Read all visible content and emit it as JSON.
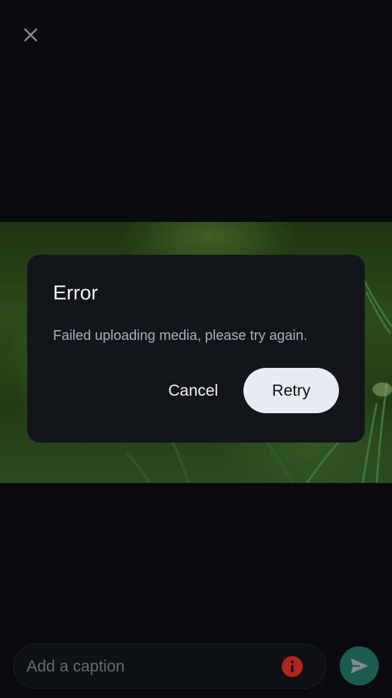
{
  "topbar": {
    "close_icon": "close-icon"
  },
  "media": {
    "description_icon": "media-preview"
  },
  "dialog": {
    "title": "Error",
    "message": "Failed uploading media, please try again.",
    "cancel_label": "Cancel",
    "retry_label": "Retry"
  },
  "composer": {
    "caption_placeholder": "Add a caption",
    "caption_value": "",
    "status_icon": "error-icon",
    "send_icon": "send-icon"
  },
  "colors": {
    "background": "#090b0e",
    "dialog_bg": "#12151a",
    "retry_bg": "#e8ebf1",
    "error_red": "#b3231f",
    "send_bg": "#1d5a4f"
  }
}
